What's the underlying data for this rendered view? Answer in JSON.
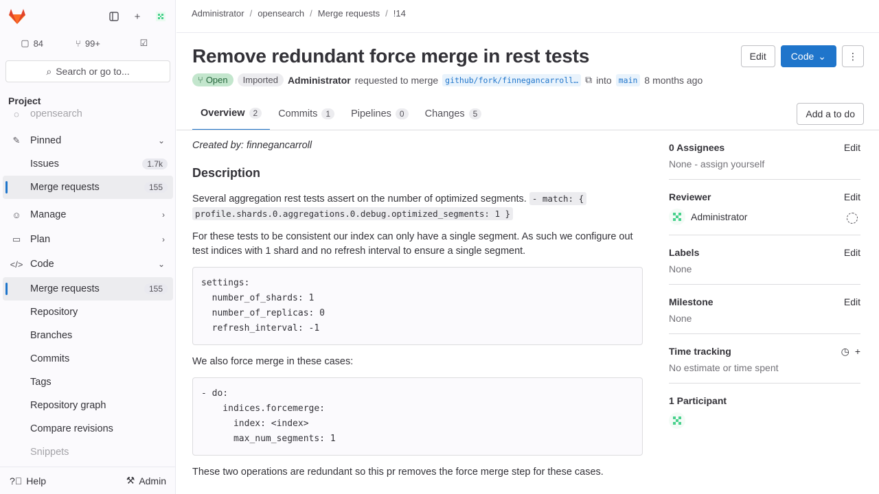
{
  "sidebar": {
    "counts": {
      "issues": "84",
      "merge_requests": "99+"
    },
    "search_label": "Search or go to...",
    "section_title": "Project",
    "project_faded": "opensearch",
    "items": [
      {
        "label": "Pinned",
        "chevron": "v"
      },
      {
        "label": "Issues",
        "badge": "1.7k"
      },
      {
        "label": "Merge requests",
        "badge": "155"
      },
      {
        "label": "Manage",
        "chevron": ">"
      },
      {
        "label": "Plan",
        "chevron": ">"
      },
      {
        "label": "Code",
        "chevron": "v"
      },
      {
        "label": "Merge requests",
        "badge": "155"
      },
      {
        "label": "Repository"
      },
      {
        "label": "Branches"
      },
      {
        "label": "Commits"
      },
      {
        "label": "Tags"
      },
      {
        "label": "Repository graph"
      },
      {
        "label": "Compare revisions"
      },
      {
        "label": "Snippets"
      }
    ],
    "help": "Help",
    "admin": "Admin"
  },
  "breadcrumb": [
    "Administrator",
    "opensearch",
    "Merge requests",
    "!14"
  ],
  "mr": {
    "title": "Remove redundant force merge in rest tests",
    "status": "Open",
    "imported": "Imported",
    "author": "Administrator",
    "requested": "requested to merge",
    "source_branch": "github/fork/finnegancarroll/...",
    "into": "into",
    "target_branch": "main",
    "time": "8 months ago",
    "edit": "Edit",
    "code": "Code",
    "todo": "Add a to do"
  },
  "tabs": [
    {
      "label": "Overview",
      "count": "2"
    },
    {
      "label": "Commits",
      "count": "1"
    },
    {
      "label": "Pipelines",
      "count": "0"
    },
    {
      "label": "Changes",
      "count": "5"
    }
  ],
  "description": {
    "created_by": "Created by: finnegancarroll",
    "heading": "Description",
    "p1": "Several aggregation rest tests assert on the number of optimized segments.",
    "p1_code_a": "  - match: {",
    "p1_code_b": "profile.shards.0.aggregations.0.debug.optimized_segments: 1 }",
    "p2": "For these tests to be consistent our index can only have a single segment. As such we configure out test indices with 1 shard and no refresh interval to ensure a single segment.",
    "code1": "settings:\n  number_of_shards: 1\n  number_of_replicas: 0\n  refresh_interval: -1",
    "p3": "We also force merge in these cases:",
    "code2": "- do:\n    indices.forcemerge:\n      index: <index>\n      max_num_segments: 1",
    "p4": "These two operations are redundant so this pr removes the force merge step for these cases."
  },
  "right": {
    "assignees_title": "0 Assignees",
    "assignees_val": "None - assign yourself",
    "reviewer_title": "Reviewer",
    "reviewer_name": "Administrator",
    "labels_title": "Labels",
    "labels_val": "None",
    "milestone_title": "Milestone",
    "milestone_val": "None",
    "time_title": "Time tracking",
    "time_val": "No estimate or time spent",
    "participants_title": "1 Participant",
    "edit": "Edit"
  },
  "colors": {
    "accent": "#1f75cb",
    "open_bg": "#c3e6cd",
    "open_fg": "#24663b",
    "brand": "#e24329"
  }
}
